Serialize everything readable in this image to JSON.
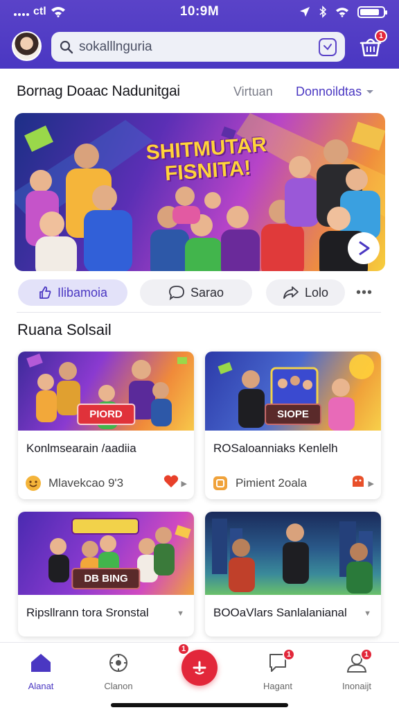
{
  "status_bar": {
    "time": "10:9M",
    "carrier": "ctl"
  },
  "header": {
    "search_text": "sokalllnguria"
  },
  "title_row": {
    "title": "Bornag Doaac Nadunitgai",
    "middle": "Virtuan",
    "dropdown": "Donnoildtas"
  },
  "hero": {
    "title_line1": "SHITMUTAR",
    "title_line2": "FISNITA!"
  },
  "actions": [
    {
      "label": "Ilibamoia"
    },
    {
      "label": "Sarao"
    },
    {
      "label": "Lolo"
    }
  ],
  "section": {
    "title": "Ruana Solsail"
  },
  "cards": [
    {
      "tag": "PIORD",
      "title": "Konlmsearain /aadiia",
      "meta": "Mlavekcao 9'3"
    },
    {
      "tag": "SIOPE",
      "title": "ROSaloanniaks Kenlelh",
      "meta": "Pimient 2oala"
    },
    {
      "tag": "DB BING",
      "title": "Ripsllrann tora Sronstal",
      "meta": ""
    },
    {
      "tag": "",
      "title": "BOOaVlars Sanlalanianal",
      "meta": ""
    }
  ],
  "bottom_nav": [
    {
      "label": "Alanat"
    },
    {
      "label": "Clanon"
    },
    {
      "label": "Hagant"
    },
    {
      "label": "Inonaijt"
    }
  ],
  "badges": {
    "basket": "1",
    "fab": "1",
    "nav3": "1",
    "nav4": "1"
  },
  "colors": {
    "primary": "#4a37c2",
    "accent": "#e2273a",
    "header_bg": "#5a43c8"
  }
}
